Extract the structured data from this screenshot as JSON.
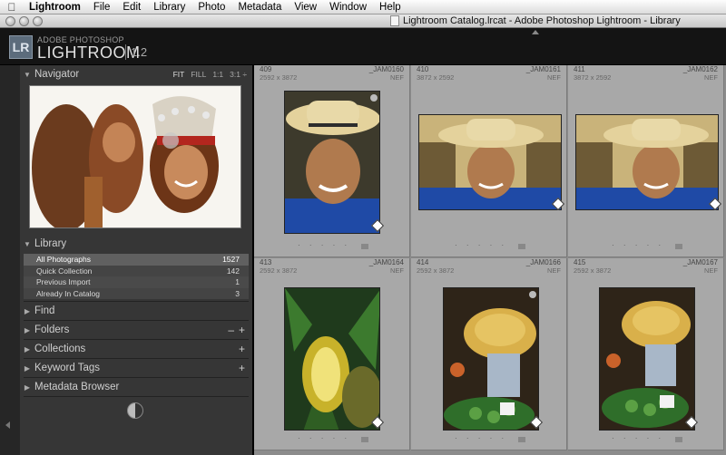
{
  "menubar": {
    "apple_icon": "apple-icon",
    "items": [
      "Lightroom",
      "File",
      "Edit",
      "Library",
      "Photo",
      "Metadata",
      "View",
      "Window",
      "Help"
    ]
  },
  "window": {
    "title": "Lightroom Catalog.lrcat - Adobe Photoshop Lightroom - Library"
  },
  "identity": {
    "logo": "LR",
    "brand_small": "ADOBE PHOTOSHOP",
    "brand_big": "LIGHTROOM",
    "version": "1.2"
  },
  "navigator": {
    "title": "Navigator",
    "options": [
      "FIT",
      "FILL",
      "1:1",
      "3:1 ÷"
    ]
  },
  "library": {
    "title": "Library",
    "items": [
      {
        "label": "All Photographs",
        "count": "1527"
      },
      {
        "label": "Quick Collection",
        "count": "142"
      },
      {
        "label": "Previous Import",
        "count": "1"
      },
      {
        "label": "Already In Catalog",
        "count": "3"
      }
    ]
  },
  "panels": [
    {
      "label": "Find"
    },
    {
      "label": "Folders"
    },
    {
      "label": "Collections"
    },
    {
      "label": "Keyword Tags"
    },
    {
      "label": "Metadata Browser"
    }
  ],
  "grid": {
    "cells": [
      {
        "idx": "409",
        "name": "_JAM0160",
        "dims": "2592 x 3872",
        "ext": "NEF"
      },
      {
        "idx": "410",
        "name": "_JAM0161",
        "dims": "3872 x 2592",
        "ext": "NEF"
      },
      {
        "idx": "411",
        "name": "_JAM0162",
        "dims": "3872 x 2592",
        "ext": "NEF"
      },
      {
        "idx": "413",
        "name": "_JAM0164",
        "dims": "2592 x 3872",
        "ext": "NEF"
      },
      {
        "idx": "414",
        "name": "_JAM0166",
        "dims": "2592 x 3872",
        "ext": "NEF"
      },
      {
        "idx": "415",
        "name": "_JAM0167",
        "dims": "2592 x 3872",
        "ext": "NEF"
      }
    ],
    "rating_dots": "· · · · ·"
  },
  "colors": {
    "panel_bg": "#363636",
    "grid_bg": "#8c8c8c",
    "cell_bg": "#a8a8a8"
  }
}
